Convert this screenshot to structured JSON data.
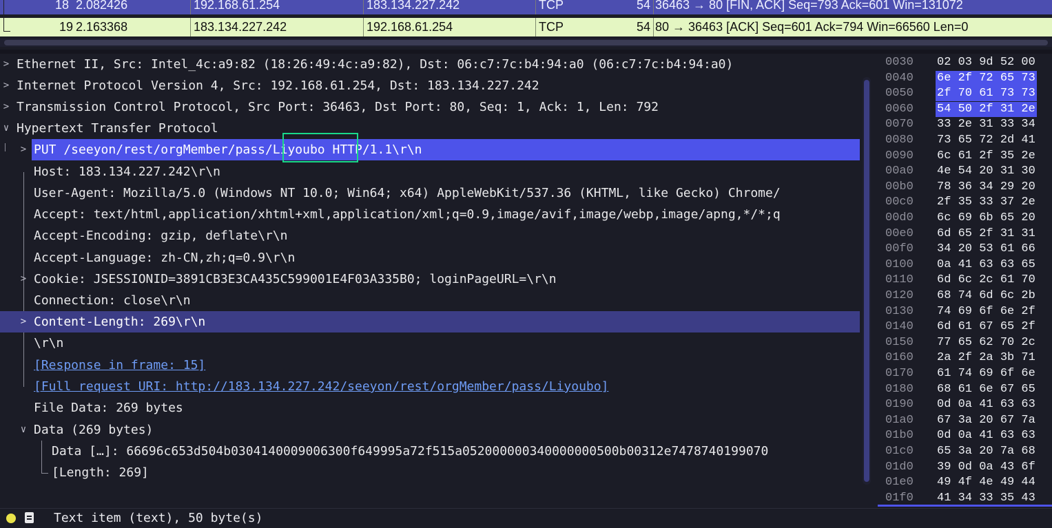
{
  "packet_list": {
    "rows": [
      {
        "no": "18",
        "time": "2.082426",
        "source": "192.168.61.254",
        "destination": "183.134.227.242",
        "protocol": "TCP",
        "length": "54",
        "info": "36463 → 80 [FIN, ACK] Seq=793 Ack=601 Win=131072"
      },
      {
        "no": "19",
        "time": "2.163368",
        "source": "183.134.227.242",
        "destination": "192.168.61.254",
        "protocol": "TCP",
        "length": "54",
        "info": "80 → 36463 [ACK] Seq=601 Ack=794 Win=66560 Len=0"
      }
    ]
  },
  "details": {
    "ethernet": "Ethernet II, Src: Intel_4c:a9:82 (18:26:49:4c:a9:82), Dst: 06:c7:7c:b4:94:a0 (06:c7:7c:b4:94:a0)",
    "ipv4": "Internet Protocol Version 4, Src: 192.168.61.254, Dst: 183.134.227.242",
    "tcp": "Transmission Control Protocol, Src Port: 36463, Dst Port: 80, Seq: 1, Ack: 1, Len: 792",
    "http": "Hypertext Transfer Protocol",
    "request_line": "PUT /seeyon/rest/orgMember/pass/Liyoubo HTTP/1.1\\r\\n",
    "host": "Host: 183.134.227.242\\r\\n",
    "user_agent": "User-Agent: Mozilla/5.0 (Windows NT 10.0; Win64; x64) AppleWebKit/537.36 (KHTML, like Gecko) Chrome/",
    "accept": "Accept: text/html,application/xhtml+xml,application/xml;q=0.9,image/avif,image/webp,image/apng,*/*;q",
    "accept_encoding": "Accept-Encoding: gzip, deflate\\r\\n",
    "accept_language": "Accept-Language: zh-CN,zh;q=0.9\\r\\n",
    "cookie": "Cookie: JSESSIONID=3891CB3E3CA435C599001E4F03A335B0; loginPageURL=\\r\\n",
    "connection": "Connection: close\\r\\n",
    "content_length": "Content-Length: 269\\r\\n",
    "crlf": "\\r\\n",
    "response_in_frame": "[Response in frame: 15]",
    "full_request_uri": "[Full request URI: http://183.134.227.242/seeyon/rest/orgMember/pass/Liyoubo]",
    "file_data": "File Data: 269 bytes",
    "data_node": "Data (269 bytes)",
    "data_value": "Data […]: 66696c653d504b0304140009006300f649995a72f515a052000000340000000500b00312e7478740199070",
    "data_length": "[Length: 269]"
  },
  "bytes": {
    "rows": [
      {
        "offset": "0030",
        "hex": "02 03 9d 52 00",
        "selected": false
      },
      {
        "offset": "0040",
        "hex": "6e 2f 72 65 73",
        "selected": true
      },
      {
        "offset": "0050",
        "hex": "2f 70 61 73 73",
        "selected": true
      },
      {
        "offset": "0060",
        "hex": "54 50 2f 31 2e",
        "selected": true
      },
      {
        "offset": "0070",
        "hex": "33 2e 31 33 34",
        "selected": false
      },
      {
        "offset": "0080",
        "hex": "73 65 72 2d 41",
        "selected": false
      },
      {
        "offset": "0090",
        "hex": "6c 61 2f 35 2e",
        "selected": false
      },
      {
        "offset": "00a0",
        "hex": "4e 54 20 31 30",
        "selected": false
      },
      {
        "offset": "00b0",
        "hex": "78 36 34 29 20",
        "selected": false
      },
      {
        "offset": "00c0",
        "hex": "2f 35 33 37 2e",
        "selected": false
      },
      {
        "offset": "00d0",
        "hex": "6c 69 6b 65 20",
        "selected": false
      },
      {
        "offset": "00e0",
        "hex": "6d 65 2f 31 31",
        "selected": false
      },
      {
        "offset": "00f0",
        "hex": "34 20 53 61 66",
        "selected": false
      },
      {
        "offset": "0100",
        "hex": "0a 41 63 63 65",
        "selected": false
      },
      {
        "offset": "0110",
        "hex": "6d 6c 2c 61 70",
        "selected": false
      },
      {
        "offset": "0120",
        "hex": "68 74 6d 6c 2b",
        "selected": false
      },
      {
        "offset": "0130",
        "hex": "74 69 6f 6e 2f",
        "selected": false
      },
      {
        "offset": "0140",
        "hex": "6d 61 67 65 2f",
        "selected": false
      },
      {
        "offset": "0150",
        "hex": "77 65 62 70 2c",
        "selected": false
      },
      {
        "offset": "0160",
        "hex": "2a 2f 2a 3b 71",
        "selected": false
      },
      {
        "offset": "0170",
        "hex": "61 74 69 6f 6e",
        "selected": false
      },
      {
        "offset": "0180",
        "hex": "68 61 6e 67 65",
        "selected": false
      },
      {
        "offset": "0190",
        "hex": "0d 0a 41 63 63",
        "selected": false
      },
      {
        "offset": "01a0",
        "hex": "67 3a 20 67 7a",
        "selected": false
      },
      {
        "offset": "01b0",
        "hex": "0d 0a 41 63 63",
        "selected": false
      },
      {
        "offset": "01c0",
        "hex": "65 3a 20 7a 68",
        "selected": false
      },
      {
        "offset": "01d0",
        "hex": "39 0d 0a 43 6f",
        "selected": false
      },
      {
        "offset": "01e0",
        "hex": "49 4f 4e 49 44",
        "selected": false
      },
      {
        "offset": "01f0",
        "hex": "41 34 33 35 43",
        "selected": false
      }
    ]
  },
  "status": {
    "text": "Text item (text), 50 byte(s)"
  },
  "colors": {
    "selection": "#4d53ea",
    "row_highlight": "#3c3d86",
    "packet_selected_bg": "#4c4eb0",
    "packet_related_bg": "#e4f6c2",
    "annotation_box": "#19d88a",
    "link": "#6f9cf5",
    "status_dot": "#e9e24a"
  },
  "icons": {
    "collapsed": "chevron-right-icon",
    "expanded": "chevron-down-icon",
    "status_indicator": "status-dot-icon",
    "edit": "edit-comment-icon"
  }
}
